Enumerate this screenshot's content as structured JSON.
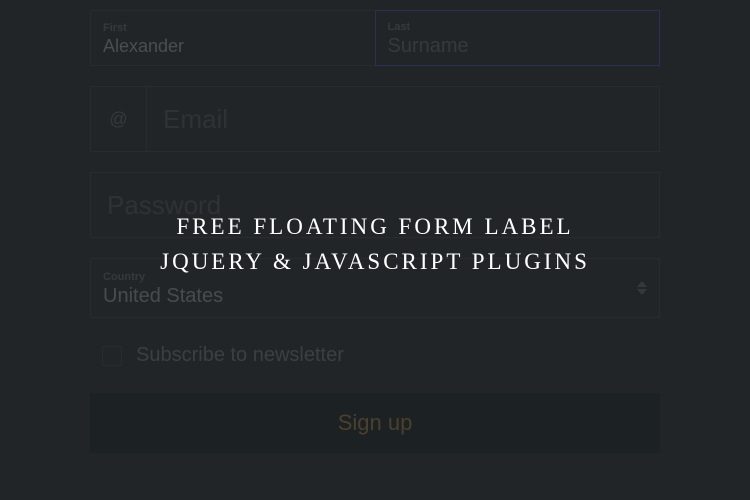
{
  "form": {
    "first": {
      "label": "First",
      "value": "Alexander"
    },
    "last": {
      "label": "Last",
      "placeholder": "Surname"
    },
    "email": {
      "prefix": "@",
      "placeholder": "Email"
    },
    "password": {
      "placeholder": "Password"
    },
    "country": {
      "label": "Country",
      "value": "United States"
    },
    "subscribe": {
      "label": "Subscribe to newsletter"
    },
    "submit": {
      "label": "Sign up"
    }
  },
  "overlay": {
    "line1": "FREE FLOATING FORM LABEL",
    "line2": "JQUERY & JAVASCRIPT PLUGINS"
  }
}
